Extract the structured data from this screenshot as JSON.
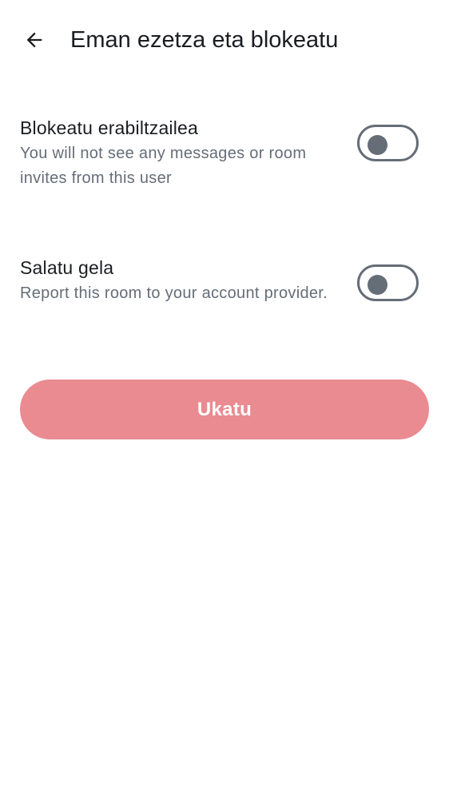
{
  "header": {
    "back_icon": "arrow-left-icon",
    "title": "Eman ezetza eta blokeatu"
  },
  "settings": [
    {
      "title": "Blokeatu erabiltzailea",
      "description": "You will not see any messages or room invites from this user",
      "enabled": false
    },
    {
      "title": "Salatu gela",
      "description": "Report this room to your account provider.",
      "enabled": false
    }
  ],
  "action": {
    "label": "Ukatu",
    "color": "#e98b91"
  },
  "colors": {
    "text_primary": "#1b1d22",
    "text_secondary": "#656d77",
    "toggle_off": "#656d77"
  }
}
